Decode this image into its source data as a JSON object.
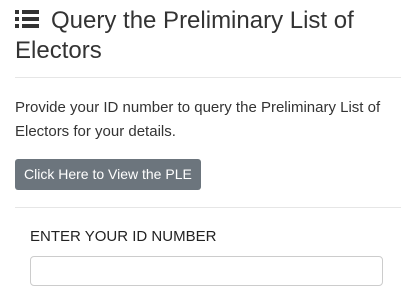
{
  "header": {
    "icon": "list-icon",
    "title": "Query the Preliminary List of Electors"
  },
  "intro": {
    "text": "Provide your ID number to query the Preliminary List of Electors for your details."
  },
  "view_button": {
    "label": "Click Here to View the PLE",
    "color": "#6c757d"
  },
  "form": {
    "id_label": "ENTER YOUR ID NUMBER",
    "id_value": ""
  }
}
